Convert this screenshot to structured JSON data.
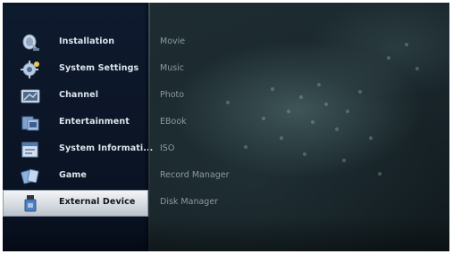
{
  "main_menu": {
    "items": [
      {
        "label": "Installation",
        "icon": "satellite-dish-icon",
        "selected": false
      },
      {
        "label": "System Settings",
        "icon": "gear-icon",
        "selected": false
      },
      {
        "label": "Channel",
        "icon": "tv-screen-icon",
        "selected": false
      },
      {
        "label": "Entertainment",
        "icon": "film-icon",
        "selected": false
      },
      {
        "label": "System Informati...",
        "icon": "info-window-icon",
        "selected": false
      },
      {
        "label": "Game",
        "icon": "game-cards-icon",
        "selected": false
      },
      {
        "label": "External Device",
        "icon": "usb-device-icon",
        "selected": true
      }
    ]
  },
  "sub_menu": {
    "items": [
      {
        "label": "Movie"
      },
      {
        "label": "Music"
      },
      {
        "label": "Photo"
      },
      {
        "label": "EBook"
      },
      {
        "label": "ISO"
      },
      {
        "label": "Record Manager"
      },
      {
        "label": "Disk Manager"
      }
    ]
  },
  "colors": {
    "panel_bg": "#0b1526",
    "selected_bg": "#d6dbe1",
    "menu_text": "#dfe5ee",
    "submenu_text": "#8e9aa0",
    "wallpaper": "#1c2a2f"
  }
}
